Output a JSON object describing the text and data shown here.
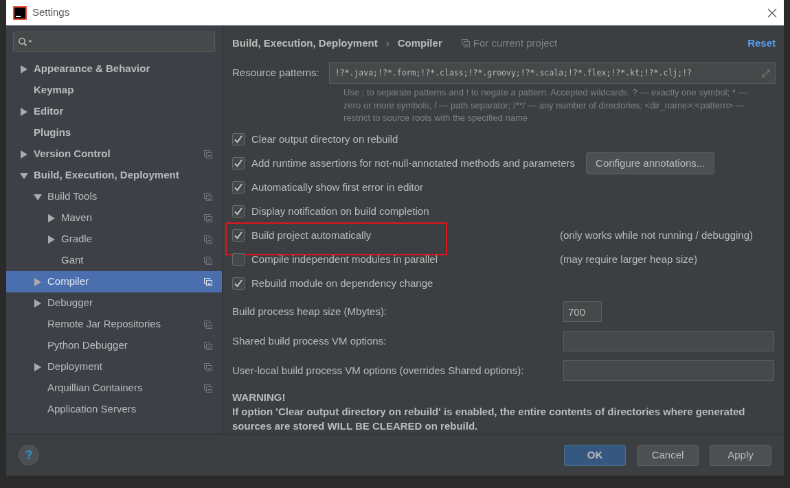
{
  "window": {
    "title": "Settings"
  },
  "help_button": "?",
  "sidebar": {
    "items": [
      {
        "label": "Appearance & Behavior",
        "kind": "branch",
        "expanded": false,
        "selected": false,
        "project_scope": false
      },
      {
        "label": "Keymap",
        "kind": "leaf",
        "selected": false,
        "project_scope": false
      },
      {
        "label": "Editor",
        "kind": "branch",
        "expanded": false,
        "selected": false,
        "project_scope": false
      },
      {
        "label": "Plugins",
        "kind": "leaf",
        "selected": false,
        "project_scope": false
      },
      {
        "label": "Version Control",
        "kind": "branch",
        "expanded": false,
        "selected": false,
        "project_scope": true
      },
      {
        "label": "Build, Execution, Deployment",
        "kind": "branch",
        "expanded": true,
        "selected": false,
        "project_scope": false,
        "children": [
          {
            "label": "Build Tools",
            "kind": "branch",
            "expanded": true,
            "selected": false,
            "project_scope": true,
            "children": [
              {
                "label": "Maven",
                "kind": "branch",
                "expanded": false,
                "selected": false,
                "project_scope": true
              },
              {
                "label": "Gradle",
                "kind": "branch",
                "expanded": false,
                "selected": false,
                "project_scope": true
              },
              {
                "label": "Gant",
                "kind": "leaf",
                "selected": false,
                "project_scope": true
              }
            ]
          },
          {
            "label": "Compiler",
            "kind": "branch",
            "expanded": false,
            "selected": true,
            "project_scope": true
          },
          {
            "label": "Debugger",
            "kind": "branch",
            "expanded": false,
            "selected": false,
            "project_scope": false
          },
          {
            "label": "Remote Jar Repositories",
            "kind": "leaf",
            "selected": false,
            "project_scope": true
          },
          {
            "label": "Python Debugger",
            "kind": "leaf",
            "selected": false,
            "project_scope": true
          },
          {
            "label": "Deployment",
            "kind": "branch",
            "expanded": false,
            "selected": false,
            "project_scope": true
          },
          {
            "label": "Arquillian Containers",
            "kind": "leaf",
            "selected": false,
            "project_scope": true
          },
          {
            "label": "Application Servers",
            "kind": "leaf",
            "selected": false,
            "project_scope": false
          }
        ]
      }
    ]
  },
  "breadcrumb": [
    "Build, Execution, Deployment",
    "›",
    "Compiler"
  ],
  "scope_label": "For current project",
  "reset_link": "Reset",
  "resource_patterns": {
    "label": "Resource patterns:",
    "value": "!?*.java;!?*.form;!?*.class;!?*.groovy;!?*.scala;!?*.flex;!?*.kt;!?*.clj;!?"
  },
  "hint": "Use ; to separate patterns and ! to negate a pattern. Accepted wildcards: ? — exactly one symbol; * — zero or more symbols; / — path separator; /**/ — any number of directories; <dir_name>:<pattern> — restrict to source roots with the specified name",
  "options": [
    {
      "label": "Clear output directory on rebuild",
      "checked": true,
      "highlighted": false
    },
    {
      "label": "Add runtime assertions for not-null-annotated methods and parameters",
      "checked": true,
      "highlighted": false,
      "button": "Configure annotations..."
    },
    {
      "label": "Automatically show first error in editor",
      "checked": true,
      "highlighted": false
    },
    {
      "label": "Display notification on build completion",
      "checked": true,
      "highlighted": false
    },
    {
      "label": "Build project automatically",
      "checked": true,
      "highlighted": true,
      "note": "(only works while not running / debugging)"
    },
    {
      "label": "Compile independent modules in parallel",
      "checked": false,
      "highlighted": false,
      "note": "(may require larger heap size)"
    },
    {
      "label": "Rebuild module on dependency change",
      "checked": true,
      "highlighted": false
    }
  ],
  "fields": [
    {
      "label": "Build process heap size (Mbytes):",
      "value": "700",
      "kind": "short"
    },
    {
      "label": "Shared build process VM options:",
      "kind": "wide"
    },
    {
      "label": "User-local build process VM options (overrides Shared options):",
      "kind": "wide"
    }
  ],
  "warning": {
    "title": "WARNING!",
    "text": "If option 'Clear output directory on rebuild' is enabled, the entire contents of directories where generated sources are stored WILL BE CLEARED on rebuild."
  },
  "buttons": [
    {
      "label": "OK",
      "default": true
    },
    {
      "label": "Cancel",
      "default": false
    },
    {
      "label": "Apply",
      "default": false
    }
  ]
}
